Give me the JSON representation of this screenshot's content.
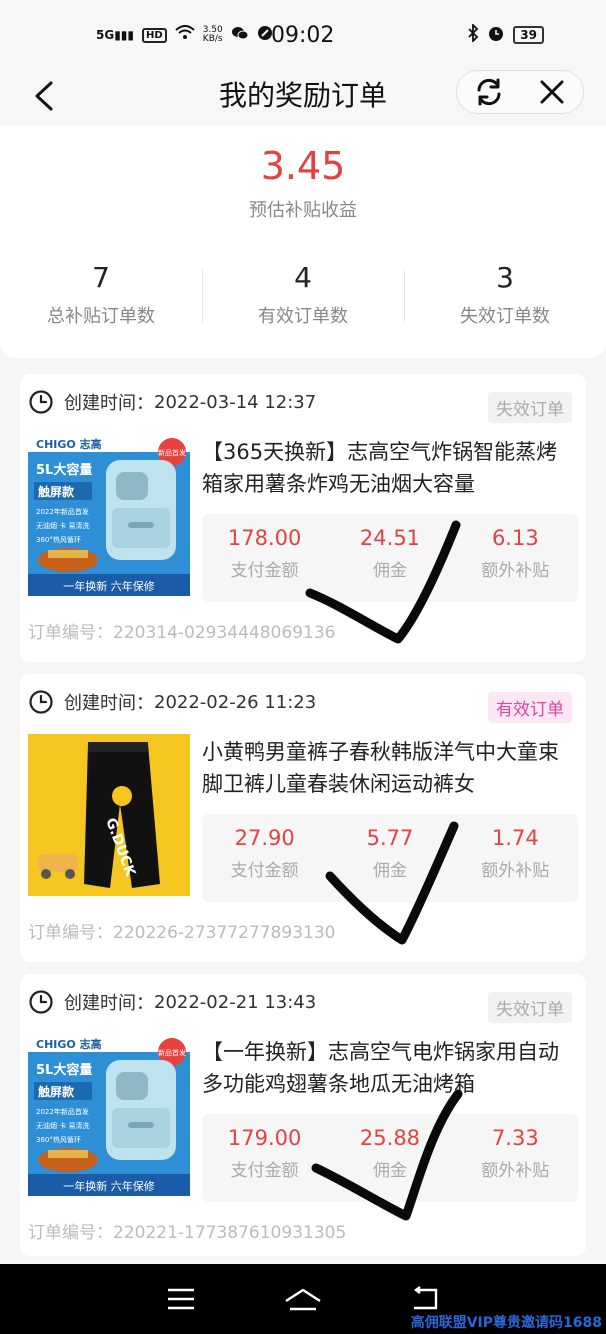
{
  "status_bar": {
    "network": "5G",
    "hd": "HD",
    "speed_value": "3.50",
    "speed_unit": "KB/s",
    "time": "09:02",
    "battery": "39"
  },
  "header": {
    "title": "我的奖励订单"
  },
  "summary": {
    "estimated_value": "3.45",
    "estimated_label": "预估补贴收益",
    "stats": [
      {
        "value": "7",
        "label": "总补贴订单数"
      },
      {
        "value": "4",
        "label": "有效订单数"
      },
      {
        "value": "3",
        "label": "失效订单数"
      }
    ]
  },
  "orders": [
    {
      "created_label": "创建时间：",
      "created_time": "2022-03-14 12:37",
      "status": "失效订单",
      "status_type": "invalid",
      "title": "【365天换新】志高空气炸锅智能蒸烤箱家用薯条炸鸡无油烟大容量",
      "image_brand": "CHIGO 志高",
      "image_lines": [
        "5L大容量",
        "触屏款",
        "2022年新品首发",
        "无油烟 卡 易清洗",
        "360°热风循环"
      ],
      "image_bottom": "一年换新 六年保修",
      "image_badge": "新品首发",
      "amounts": [
        {
          "value": "178.00",
          "label": "支付金额"
        },
        {
          "value": "24.51",
          "label": "佣金"
        },
        {
          "value": "6.13",
          "label": "额外补贴"
        }
      ],
      "order_no_label": "订单编号：",
      "order_no": "220314-02934448069136"
    },
    {
      "created_label": "创建时间：",
      "created_time": "2022-02-26 11:23",
      "status": "有效订单",
      "status_type": "valid",
      "title": "小黄鸭男童裤子春秋韩版洋气中大童束脚卫裤儿童春装休闲运动裤女",
      "image_text": "G.DUCK",
      "amounts": [
        {
          "value": "27.90",
          "label": "支付金额"
        },
        {
          "value": "5.77",
          "label": "佣金"
        },
        {
          "value": "1.74",
          "label": "额外补贴"
        }
      ],
      "order_no_label": "订单编号：",
      "order_no": "220226-27377277893130"
    },
    {
      "created_label": "创建时间：",
      "created_time": "2022-02-21 13:43",
      "status": "失效订单",
      "status_type": "invalid",
      "title": "【一年换新】志高空气电炸锅家用自动多功能鸡翅薯条地瓜无油烤箱",
      "image_brand": "CHIGO 志高",
      "image_lines": [
        "5L大容量",
        "触屏款",
        "2022年新品首发",
        "无油烟 卡 易清洗",
        "360°热风循环"
      ],
      "image_bottom": "一年换新 六年保修",
      "image_badge": "新品首发",
      "amounts": [
        {
          "value": "179.00",
          "label": "支付金额"
        },
        {
          "value": "25.88",
          "label": "佣金"
        },
        {
          "value": "7.33",
          "label": "额外补贴"
        }
      ],
      "order_no_label": "订单编号：",
      "order_no": "220221-177387610931305"
    }
  ],
  "watermark": "高佣联盟VIP尊贵邀请码1688",
  "colors": {
    "accent_red": "#e8403e",
    "valid_tag_bg": "#fde7f4",
    "valid_tag_text": "#d9489f",
    "invalid_tag_bg": "#f2f2f2",
    "invalid_tag_text": "#aaaaaa",
    "watermark": "#2b66d9"
  },
  "icons": {
    "back": "chevron-left-icon",
    "refresh": "refresh-icon",
    "close": "close-icon",
    "clock": "clock-icon",
    "nav_menu": "menu-icon",
    "nav_home": "home-icon",
    "nav_back": "back-icon"
  }
}
